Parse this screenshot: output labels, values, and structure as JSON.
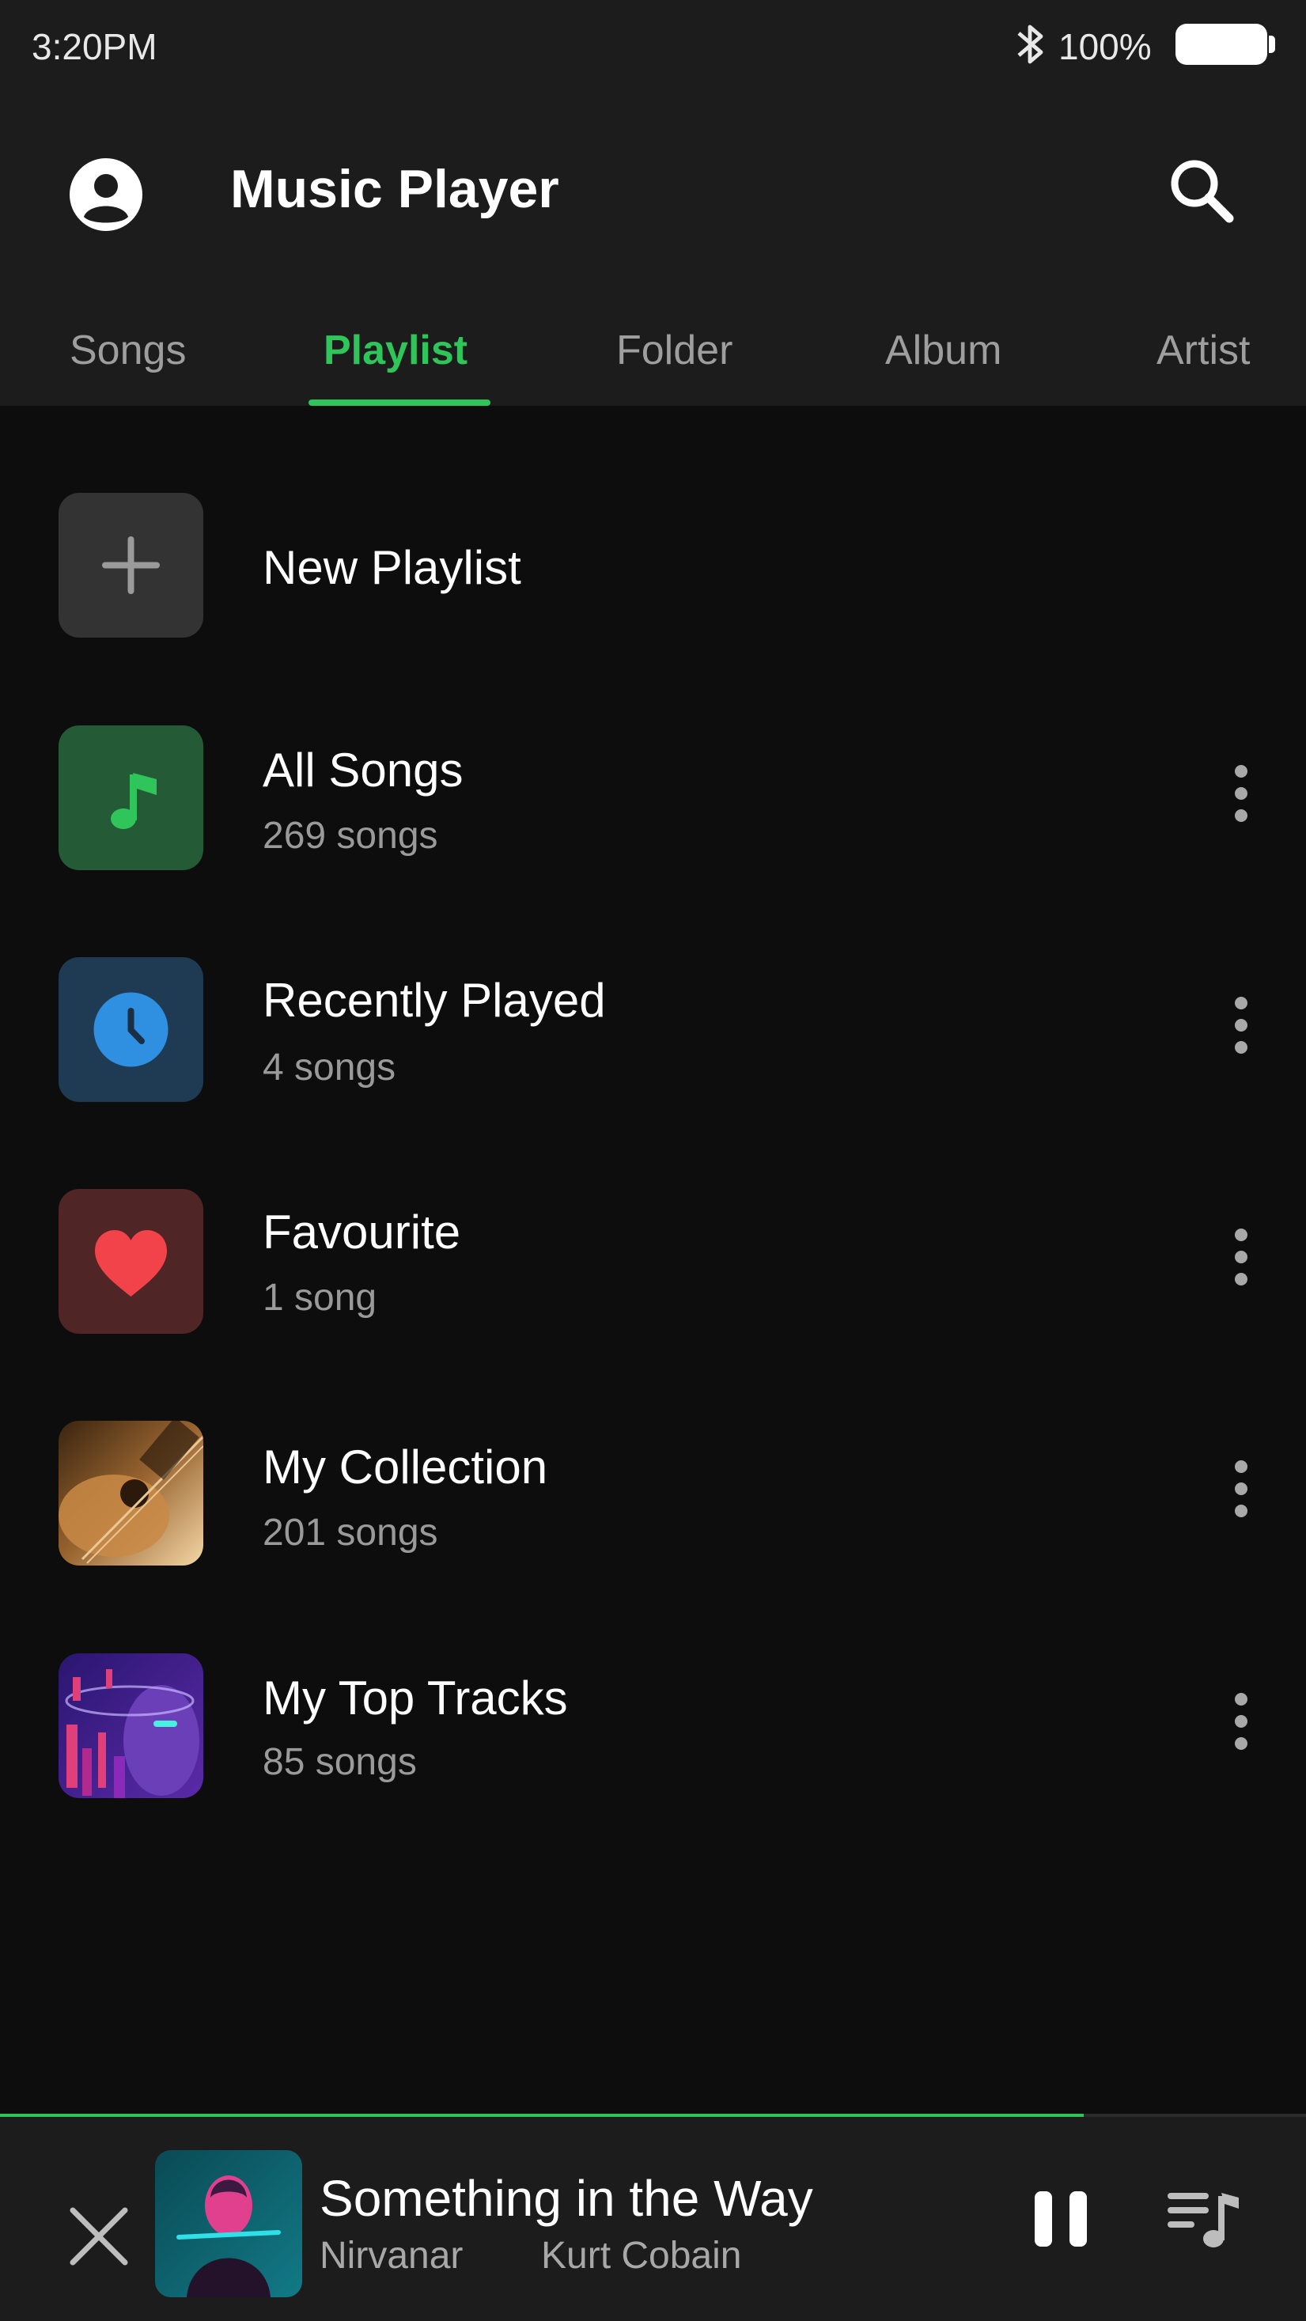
{
  "status_bar": {
    "time": "3:20PM",
    "battery": "100%"
  },
  "app": {
    "title": "Music Player"
  },
  "tabs": [
    {
      "label": "Songs"
    },
    {
      "label": "Playlist"
    },
    {
      "label": "Folder"
    },
    {
      "label": "Album"
    },
    {
      "label": "Artist"
    }
  ],
  "active_tab": "Playlist",
  "playlists": {
    "new": {
      "name": "New Playlist",
      "icon": "plus-icon"
    },
    "items": [
      {
        "name": "All Songs",
        "count": "269 songs",
        "icon": "music-note-icon",
        "tile_color": "#245a35",
        "icon_color": "#2fc55a"
      },
      {
        "name": "Recently Played",
        "count": "4 songs",
        "icon": "clock-icon",
        "tile_color": "#1f3b54",
        "icon_color": "#2f8fe0"
      },
      {
        "name": "Favourite",
        "count": "1 song",
        "icon": "heart-icon",
        "tile_color": "#4f2526",
        "icon_color": "#f2434a"
      },
      {
        "name": "My Collection",
        "count": "201 songs",
        "icon": "guitar-artwork"
      },
      {
        "name": "My Top Tracks",
        "count": "85 songs",
        "icon": "cyber-face-artwork"
      }
    ]
  },
  "now_playing": {
    "title": "Something in the Way",
    "album": "Nirvanar",
    "artist": "Kurt Cobain",
    "progress": 0.83
  },
  "colors": {
    "accent": "#2fc55a",
    "background": "#0d0d0d",
    "bar": "#1c1c1c"
  }
}
